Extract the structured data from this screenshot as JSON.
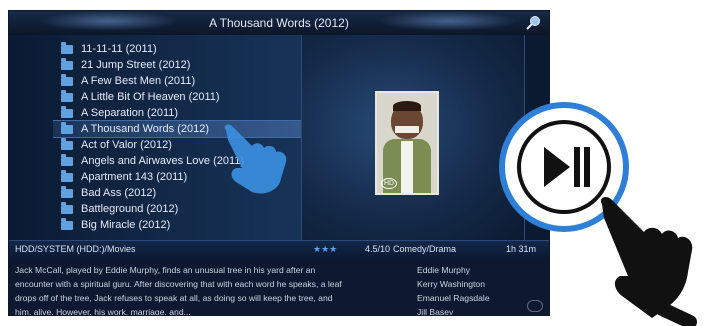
{
  "window": {
    "title": "A Thousand Words (2012)"
  },
  "list": {
    "items": [
      {
        "label": "11-11-11 (2011)"
      },
      {
        "label": "21 Jump Street (2012)"
      },
      {
        "label": "A Few Best Men (2011)"
      },
      {
        "label": "A Little Bit Of Heaven (2011)"
      },
      {
        "label": "A Separation (2011)"
      },
      {
        "label": "A Thousand Words (2012)",
        "selected": true
      },
      {
        "label": "Act of Valor (2012)"
      },
      {
        "label": "Angels and Airwaves Love (2011)"
      },
      {
        "label": "Apartment 143 (2011)"
      },
      {
        "label": "Bad Ass (2012)"
      },
      {
        "label": "Battleground (2012)"
      },
      {
        "label": "Big Miracle (2012)"
      }
    ]
  },
  "poster": {
    "badge": "HD"
  },
  "info": {
    "path": "HDD/SYSTEM (HDD:)/Movies",
    "rating_stars": "★★★",
    "rating": "4.5/10",
    "genre": "Comedy/Drama",
    "runtime": "1h 31m"
  },
  "description": {
    "plot_lines": [
      "Jack McCall, played by Eddie Murphy, finds an unusual tree in his yard after an",
      "encounter with a spiritual guru. After discovering that with each word he speaks, a leaf",
      "drops off of the tree, Jack refuses to speak at all, as doing so will keep the tree, and",
      "him, alive. However, his work, marriage, and..."
    ],
    "cast": [
      "Eddie Murphy",
      "Kerry Washington",
      "Emanuel Ragsdale",
      "Jill Basey"
    ]
  },
  "icons": {
    "search": "search-icon",
    "folder": "folder-icon",
    "play_pause": "play-pause-icon",
    "hand": "hand-pointer-icon"
  },
  "colors": {
    "accent": "#2f7fd6",
    "background": "#071223"
  }
}
